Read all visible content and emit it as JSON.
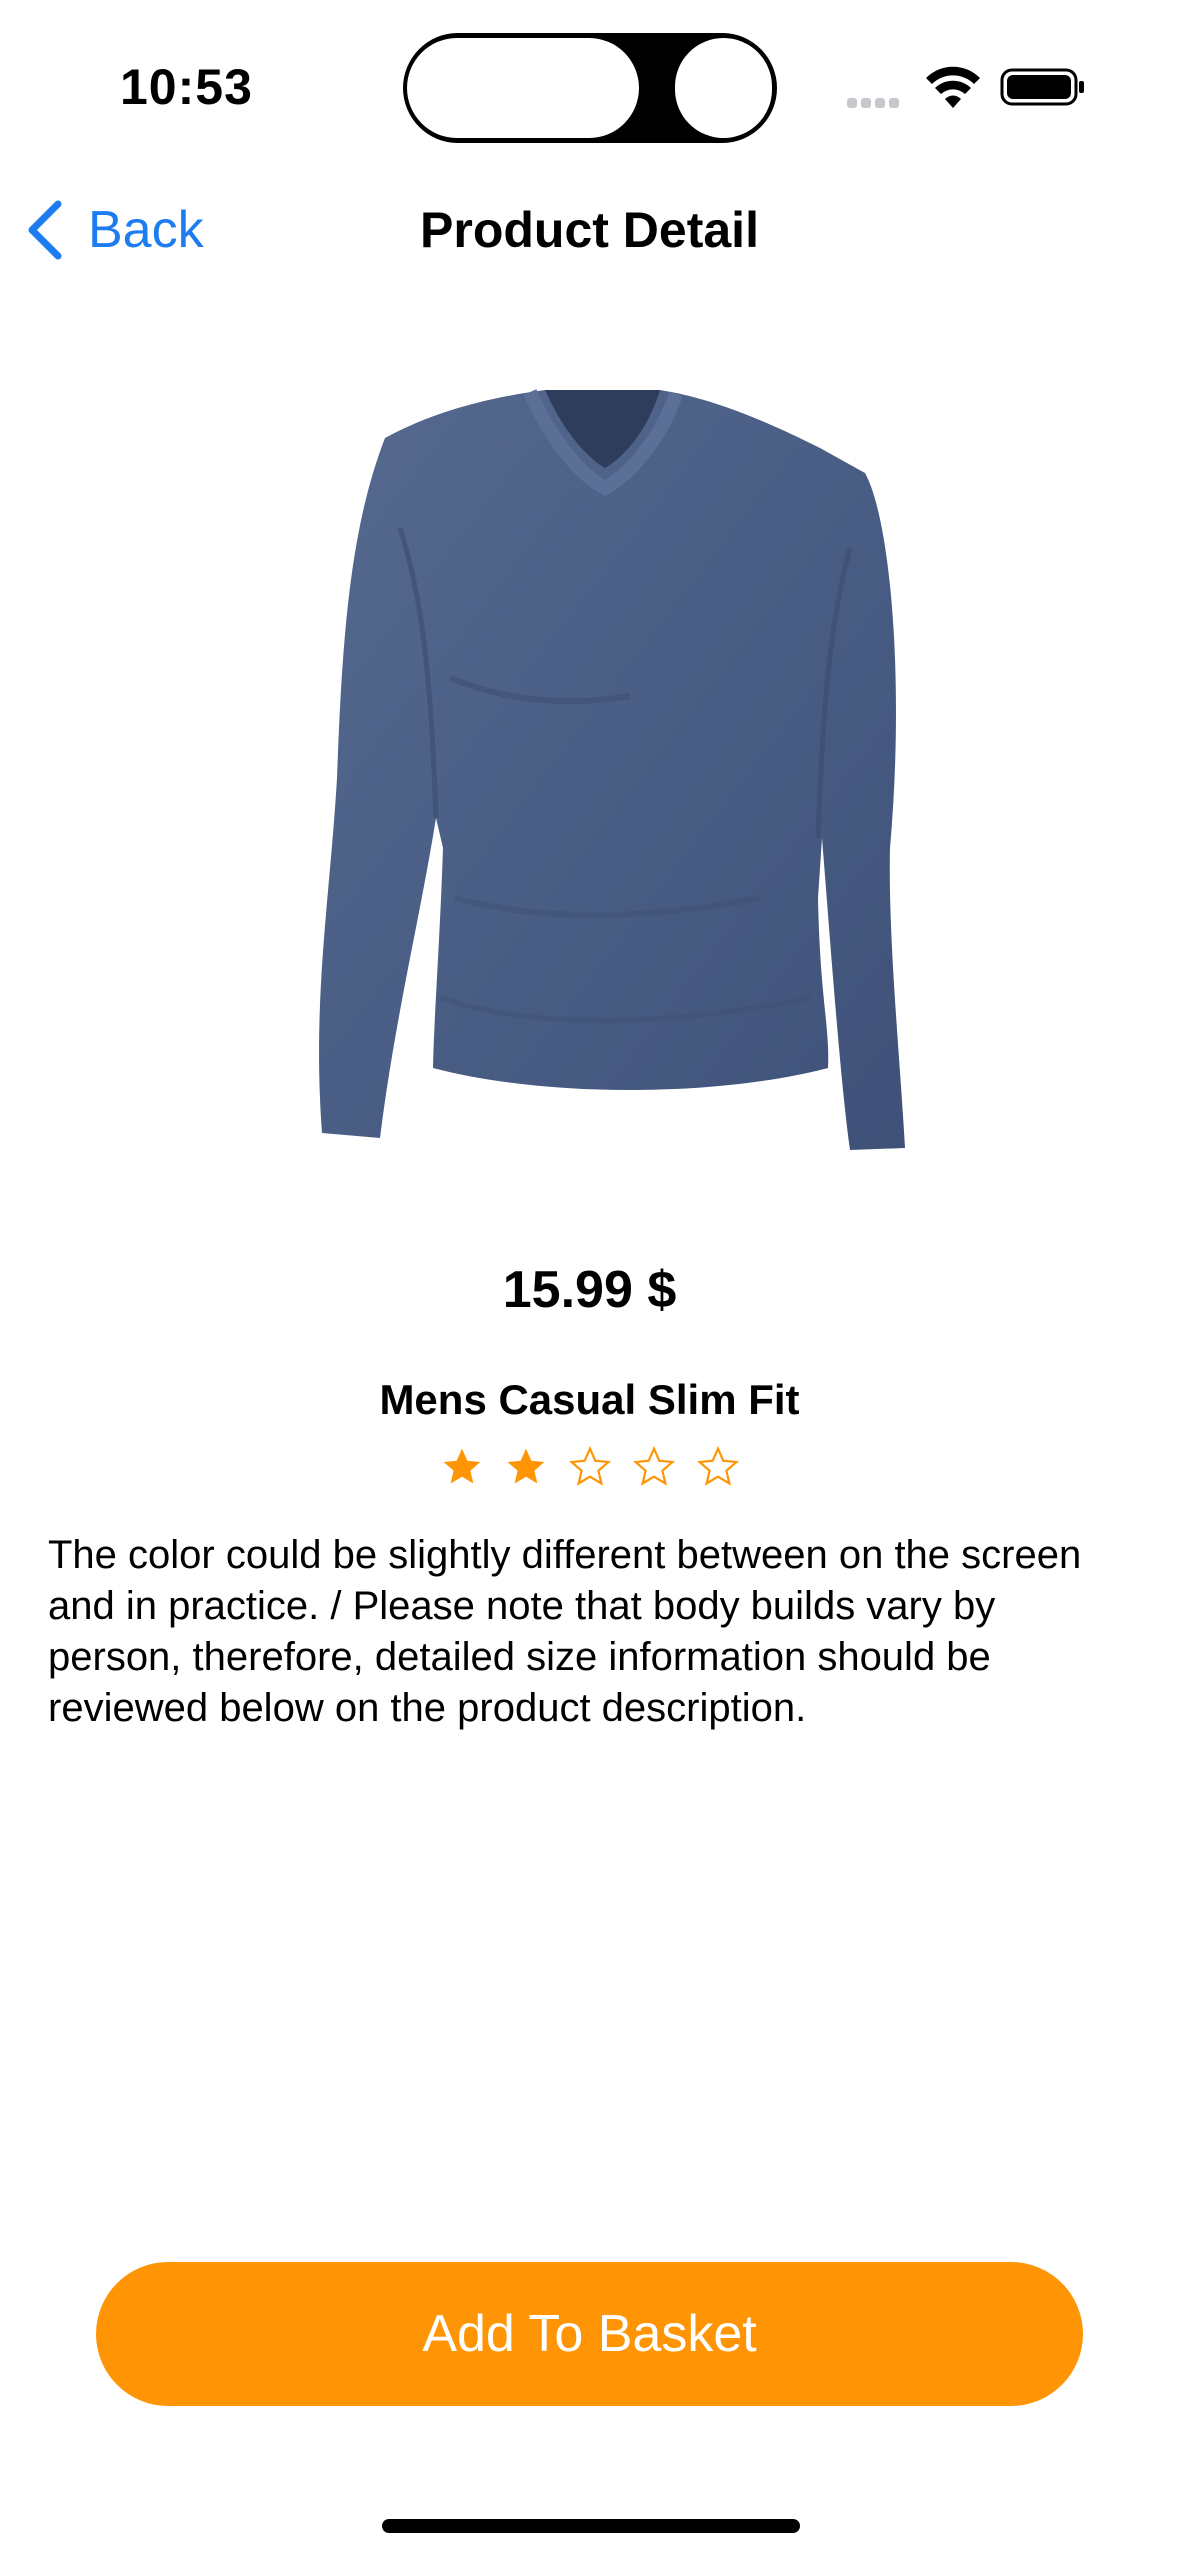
{
  "status_bar": {
    "time": "10:53"
  },
  "nav": {
    "back_label": "Back",
    "title": "Product Detail"
  },
  "product": {
    "image_icon": "tshirt-image",
    "price": "15.99 $",
    "name": "Mens Casual Slim Fit",
    "rating": {
      "value": 2,
      "max": 5
    },
    "description": "The color could be slightly different between on the screen and in practice. / Please note that body builds vary by person, therefore, detailed size information should be reviewed below on the product description."
  },
  "actions": {
    "add_to_basket": "Add To Basket"
  },
  "colors": {
    "accent": "#ff9505",
    "link": "#1c7cf0",
    "shirt": "#4a5f85"
  }
}
